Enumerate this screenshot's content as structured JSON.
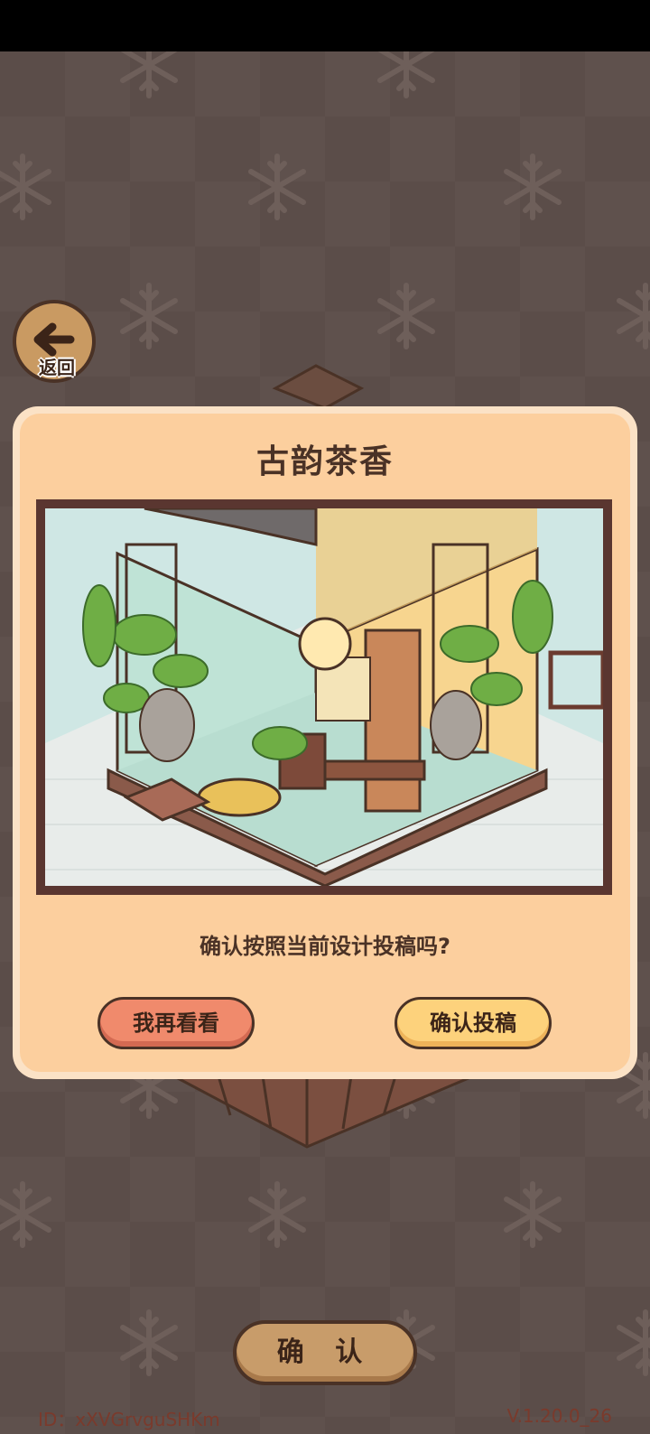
{
  "back_button": {
    "label": "返回",
    "icon": "arrow-left-icon"
  },
  "dialog": {
    "title": "古韵茶香",
    "question": "确认按照当前设计投稿吗?",
    "cancel_label": "我再看看",
    "submit_label": "确认投稿"
  },
  "confirm_label": "确 认",
  "footer": {
    "user_id": "ID：xXVGrvguSHKm",
    "version": "V.1.20.0_26"
  },
  "colors": {
    "background": "#5b4d49",
    "dialog_fill": "#fccf9e",
    "cancel_button": "#f08a6c",
    "submit_button": "#fdd27c",
    "text_dark": "#4a3226"
  }
}
